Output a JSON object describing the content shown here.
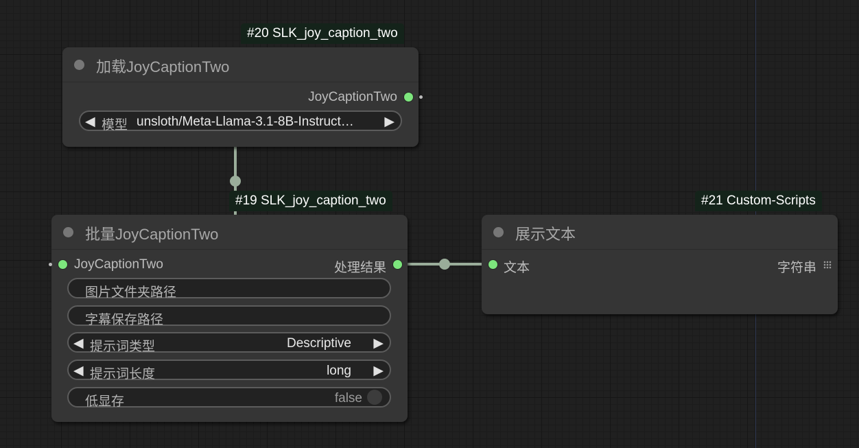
{
  "nodes": {
    "load": {
      "badge": "#20 SLK_joy_caption_two",
      "title": "加载JoyCaptionTwo",
      "output_label": "JoyCaptionTwo",
      "model_widget": {
        "name": "模型",
        "value": "unsloth/Meta-Llama-3.1-8B-Instruct…"
      }
    },
    "batch": {
      "badge": "#19 SLK_joy_caption_two",
      "title": "批量JoyCaptionTwo",
      "input_label": "JoyCaptionTwo",
      "output_label": "处理结果",
      "widgets": {
        "image_folder": "图片文件夹路径",
        "caption_save": "字幕保存路径",
        "prompt_type": {
          "name": "提示词类型",
          "value": "Descriptive"
        },
        "prompt_length": {
          "name": "提示词长度",
          "value": "long"
        },
        "low_vram": {
          "name": "低显存",
          "value": "false"
        }
      }
    },
    "show": {
      "badge": "#21 Custom-Scripts",
      "title": "展示文本",
      "input_label": "文本",
      "output_label": "字符串"
    }
  },
  "icons": {
    "left_arrow": "◀",
    "right_arrow": "▶"
  },
  "colors": {
    "slot_green": "#7de67d",
    "link": "#9aad9a",
    "badge_bg": "#14231a",
    "node_bg": "#353535"
  }
}
